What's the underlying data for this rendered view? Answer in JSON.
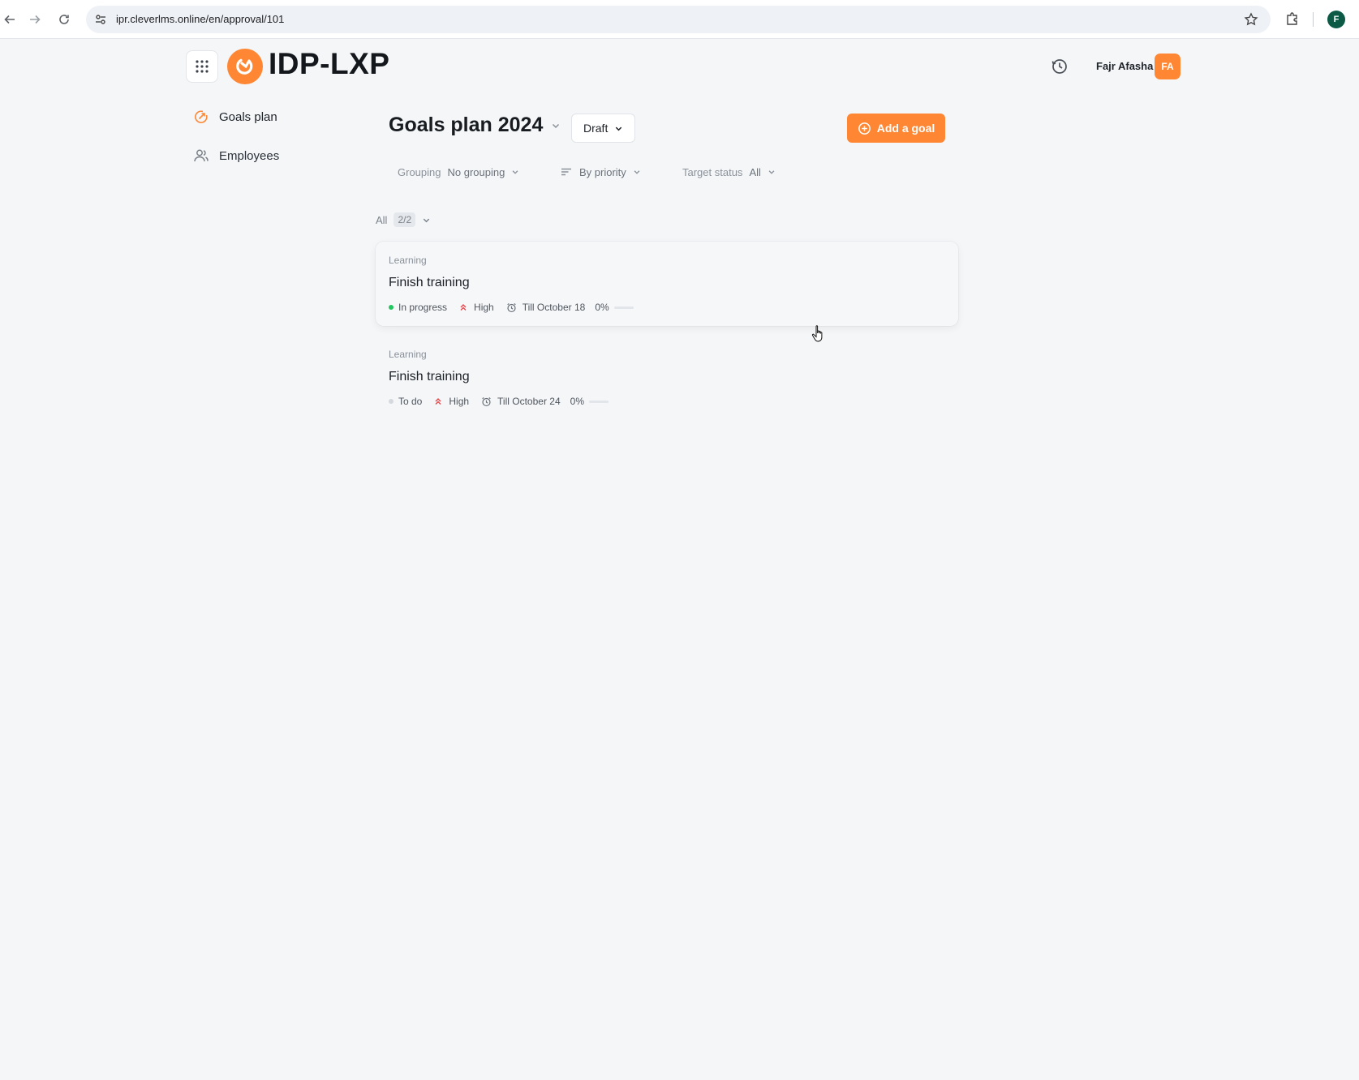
{
  "browser": {
    "url": "ipr.cleverlms.online/en/approval/101",
    "profile_initial": "F"
  },
  "app": {
    "name": "IDP-LXP",
    "brand_color": "#ff8733",
    "user": {
      "name": "Fajr Afasha",
      "initials": "FA"
    }
  },
  "sidebar": {
    "items": [
      {
        "label": "Goals plan",
        "icon": "target-arrow-icon",
        "active": true
      },
      {
        "label": "Employees",
        "icon": "users-icon",
        "active": false
      }
    ]
  },
  "plan": {
    "title": "Goals plan 2024",
    "status_label": "Draft",
    "add_goal_label": "Add a goal"
  },
  "filters": {
    "grouping_label": "Grouping",
    "grouping_value": "No grouping",
    "sort_value": "By priority",
    "target_status_label": "Target status",
    "target_status_value": "All"
  },
  "group": {
    "label": "All",
    "count": "2/2"
  },
  "goals": [
    {
      "category": "Learning",
      "title": "Finish training",
      "status": "In progress",
      "status_color": "#22c55e",
      "priority": "High",
      "priority_color": "#e5484d",
      "deadline": "Till October 18",
      "progress_label": "0%",
      "progress": 0
    },
    {
      "category": "Learning",
      "title": "Finish training",
      "status": "To do",
      "status_color": "#d5d9de",
      "priority": "High",
      "priority_color": "#e5484d",
      "deadline": "Till October 24",
      "progress_label": "0%",
      "progress": 0
    }
  ]
}
